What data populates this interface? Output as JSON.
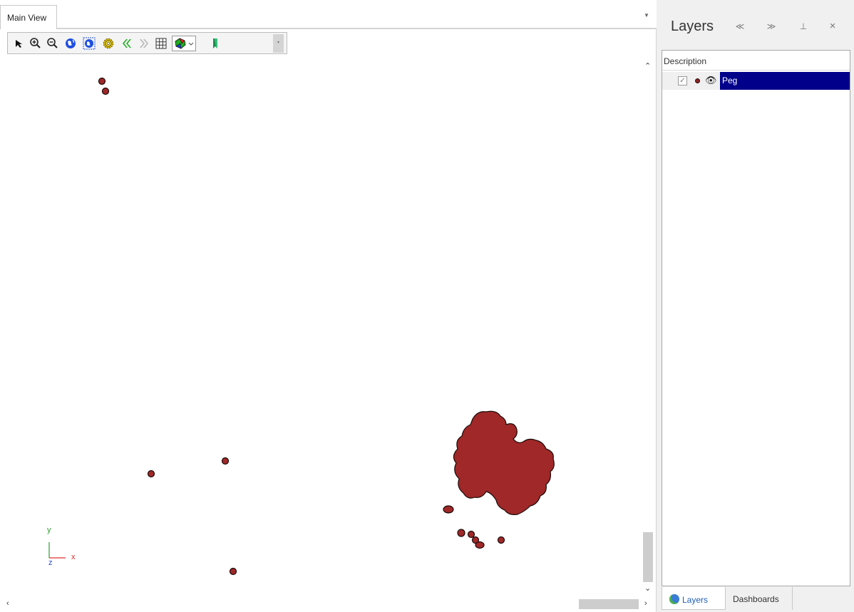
{
  "doc_tab": {
    "label": "Main View"
  },
  "toolbar": {
    "buttons": [
      "select-arrow-icon",
      "zoom-in-icon",
      "zoom-out-icon",
      "globe-icon",
      "globe-extent-icon",
      "gear-icon",
      "back-icon",
      "forward-icon",
      "grid-icon",
      "palette-dropdown-icon",
      "marker-icon"
    ],
    "more": "▾"
  },
  "axes": {
    "y": "y",
    "x": "x",
    "z": "z",
    "x_color": "#e03030",
    "y_color": "#2a9d2a",
    "z_color": "#2a4bd0"
  },
  "map": {
    "feature_fill": "#a02828",
    "feature_stroke": "#1a0a0a"
  },
  "scroll": {
    "up": "^",
    "down": "v",
    "left": "<",
    "right": ">"
  },
  "panel": {
    "title": "Layers",
    "collapse": "≪",
    "expand": "≫",
    "pin": "⊥",
    "close": "×",
    "column_header": "Description",
    "layers": [
      {
        "name": "Peg",
        "checked": "✓",
        "visible_icon": "👁"
      }
    ],
    "tabs": {
      "layers": "Layers",
      "dashboards": "Dashboards"
    }
  }
}
